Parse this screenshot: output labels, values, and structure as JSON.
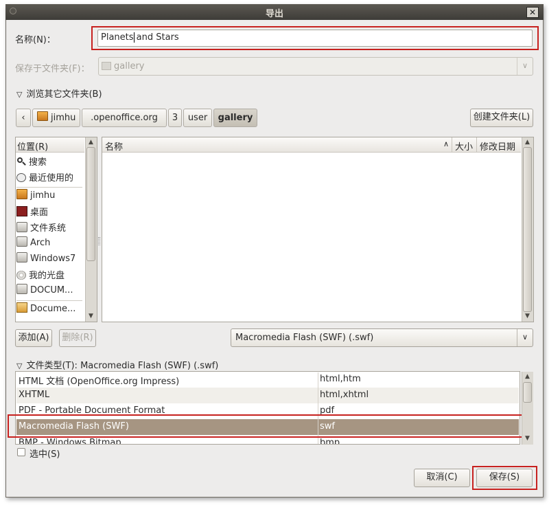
{
  "window": {
    "title": "导出",
    "close_glyph": "✕"
  },
  "name_row": {
    "label": "名称(N)：",
    "value_before_caret": "Planets",
    "value_after_caret": " and Stars"
  },
  "folder_row": {
    "label": "保存于文件夹(F)：",
    "value": "gallery"
  },
  "browse": {
    "label": "浏览其它文件夹(B)"
  },
  "path_bar": {
    "back_glyph": "‹",
    "crumbs": [
      {
        "label": "jimhu"
      },
      {
        "label": ".openoffice.org"
      },
      {
        "label": "3"
      },
      {
        "label": "user"
      },
      {
        "label": "gallery"
      }
    ],
    "create_folder_label": "创建文件夹(L)"
  },
  "places": {
    "header": "位置(R)",
    "items": [
      {
        "label": "搜索",
        "icon": "search-icon"
      },
      {
        "label": "最近使用的",
        "icon": "recent-icon"
      },
      {
        "label": "jimhu",
        "icon": "home-folder-icon"
      },
      {
        "label": "桌面",
        "icon": "desktop-icon"
      },
      {
        "label": "文件系统",
        "icon": "drive-icon"
      },
      {
        "label": "Arch",
        "icon": "drive-icon"
      },
      {
        "label": "Windows7",
        "icon": "drive-icon"
      },
      {
        "label": "我的光盘",
        "icon": "cdrom-icon"
      },
      {
        "label": "DOCUM...",
        "icon": "drive-icon"
      },
      {
        "label": "Docume...",
        "icon": "documents-folder-icon"
      }
    ],
    "add_label": "添加(A)",
    "remove_label": "删除(R)"
  },
  "files": {
    "col_name": "名称",
    "col_size": "大小",
    "col_modified": "修改日期",
    "filter_value": "Macromedia Flash (SWF) (.swf)"
  },
  "file_type": {
    "label": "文件类型(T): Macromedia Flash (SWF) (.swf)",
    "rows": [
      {
        "name": "HTML 文档 (OpenOffice.org Impress)",
        "ext": "html,htm"
      },
      {
        "name": "XHTML",
        "ext": "html,xhtml"
      },
      {
        "name": "PDF - Portable Document Format",
        "ext": "pdf"
      },
      {
        "name": "Macromedia Flash (SWF)",
        "ext": "swf"
      },
      {
        "name": "BMP - Windows Bitmap",
        "ext": "bmp"
      }
    ],
    "selected_index": 3
  },
  "selection_checkbox": {
    "label": "选中(S)",
    "checked": false
  },
  "buttons": {
    "cancel": "取消(C)",
    "save": "保存(S)"
  },
  "colors": {
    "highlight_border": "#c7211f",
    "selected_row": "#a69582",
    "titlebar": "#3e3c38"
  }
}
